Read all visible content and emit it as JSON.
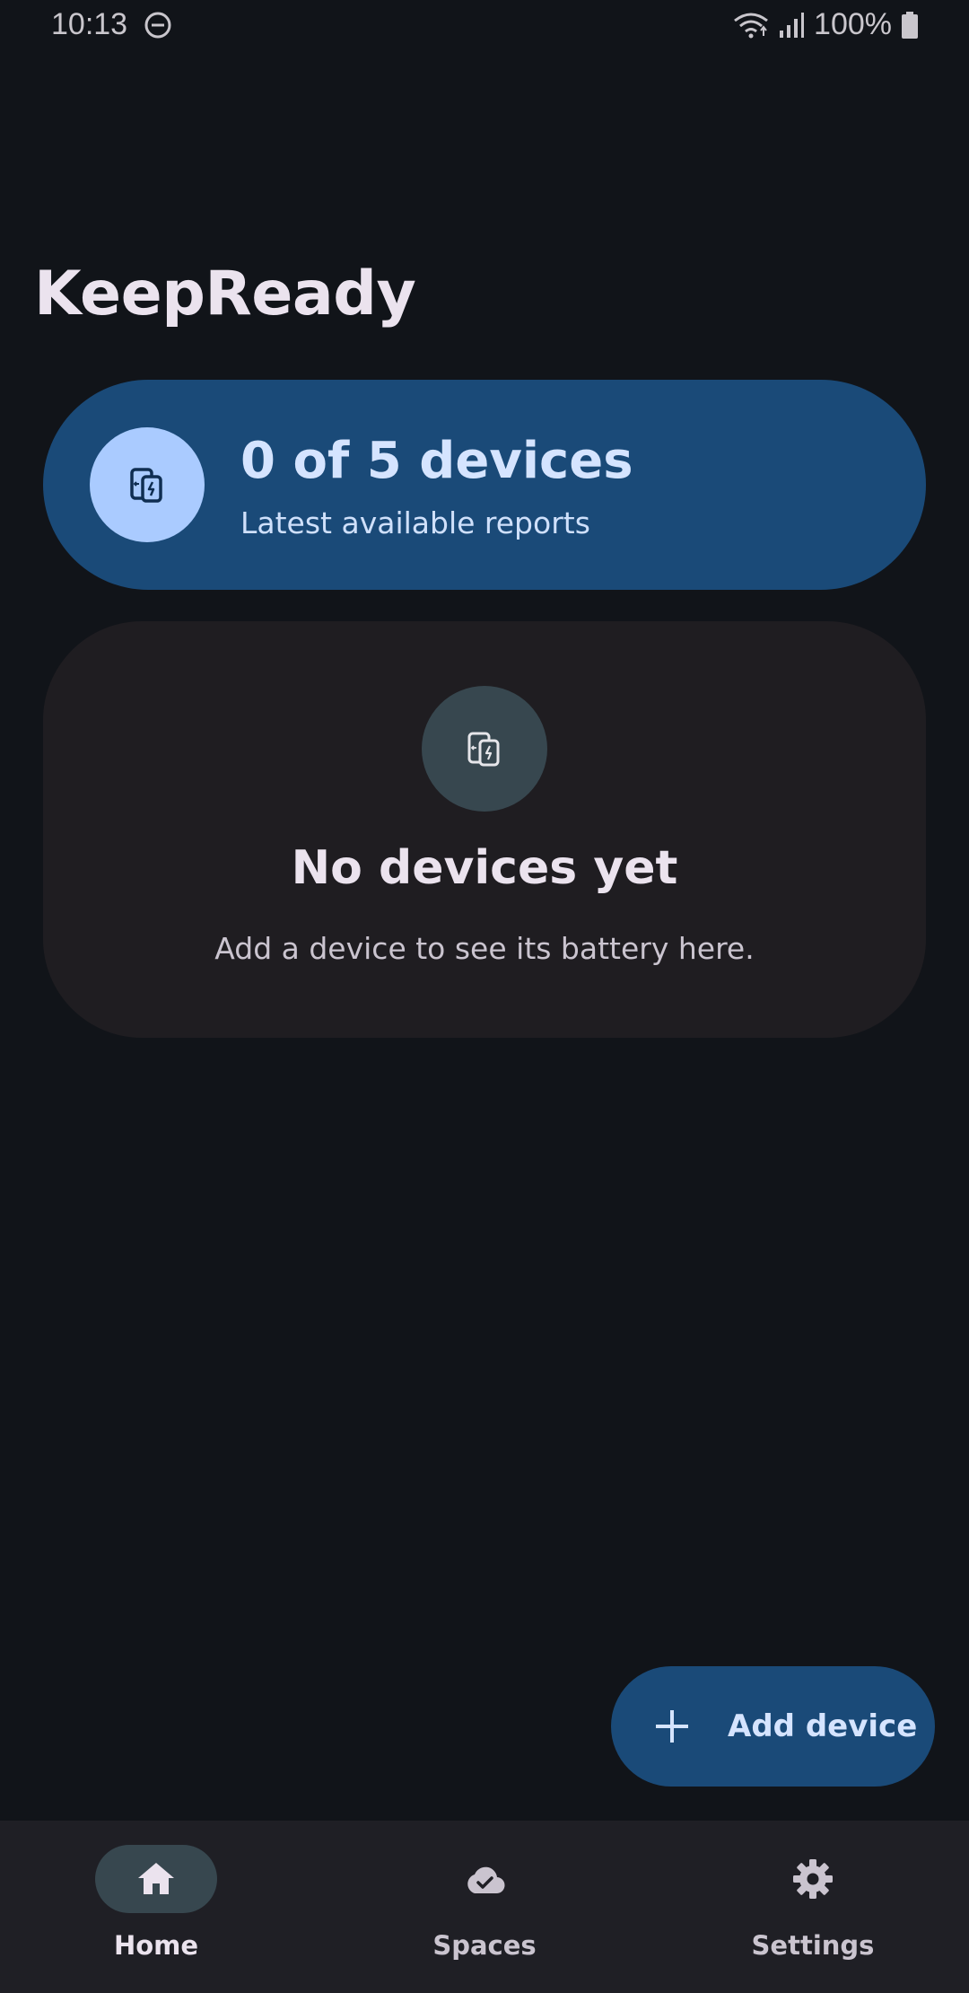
{
  "status_bar": {
    "time": "10:13",
    "battery_text": "100%",
    "icons": [
      "do-not-disturb-icon",
      "wifi-icon",
      "signal-icon",
      "battery-icon"
    ]
  },
  "app": {
    "title": "KeepReady"
  },
  "summary_card": {
    "title": "0 of 5 devices",
    "subtitle": "Latest available reports",
    "icon": "devices-battery-icon"
  },
  "empty_state": {
    "title": "No devices yet",
    "subtitle": "Add a device to see its battery here.",
    "icon": "devices-battery-icon"
  },
  "fab": {
    "label": "Add device",
    "icon": "plus-icon"
  },
  "bottom_nav": {
    "items": [
      {
        "label": "Home",
        "icon": "home-icon",
        "active": true
      },
      {
        "label": "Spaces",
        "icon": "cloud-check-icon",
        "active": false
      },
      {
        "label": "Settings",
        "icon": "gear-icon",
        "active": false
      }
    ]
  },
  "colors": {
    "background": "#111419",
    "primary_container": "#1a4a78",
    "on_primary_container": "#d5e4ff",
    "icon_circle": "#aacbff",
    "surface_container": "#1f1d21",
    "nav_background": "#1f1f25",
    "nav_active_pill": "#37474f"
  }
}
